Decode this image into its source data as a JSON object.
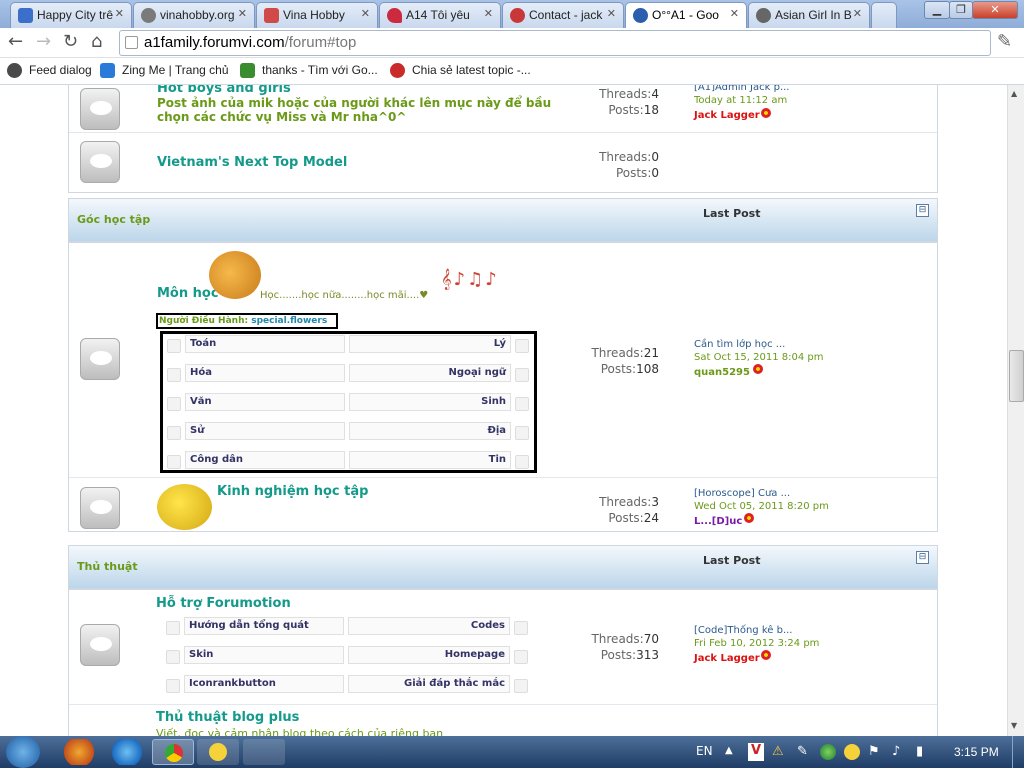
{
  "tabs": [
    {
      "label": "Happy City trê",
      "color": "#3b6fc9"
    },
    {
      "label": "vinahobby.org",
      "color": "#7a7a7a"
    },
    {
      "label": "Vina Hobby",
      "color": "#d04a4a"
    },
    {
      "label": "A14 Tôi yêu",
      "color": "#cc2b3f"
    },
    {
      "label": "Contact - jack",
      "color": "#c93838"
    },
    {
      "label": "O°°A1 - Goo",
      "color": "#2b5fae"
    },
    {
      "label": "Asian Girl In B",
      "color": "#666666"
    }
  ],
  "toolbar": {
    "url_domain": "a1family.forumvi.com",
    "url_path": "/forum#top"
  },
  "bookmarks": [
    {
      "label": "Feed dialog",
      "color": "#4a4a4a"
    },
    {
      "label": "Zing Me | Trang chủ",
      "color": "#2a7ad9"
    },
    {
      "label": "thanks - Tìm với Go...",
      "color": "#3a8d2e"
    },
    {
      "label": "Chia sẻ latest topic -...",
      "color": "#c92b2b"
    }
  ],
  "forum": {
    "hot": {
      "title": "Hot boys and girls",
      "desc": "Post ảnh của mik hoặc của người khác lên mục này để bầu chọn các chức vụ Miss và Mr nha^0^",
      "threads_label": "Threads:",
      "threads": "4",
      "posts_label": "Posts:",
      "posts": "18",
      "lp_title": "[A1]Admin Jack p...",
      "lp_date": "Today at 11:12 am",
      "lp_user": "Jack Lagger"
    },
    "vntm": {
      "title": "Vietnam's Next Top Model",
      "threads_label": "Threads:",
      "threads": "0",
      "posts_label": "Posts:",
      "posts": "0"
    },
    "cat1": {
      "title": "Góc học tập",
      "last_post": "Last Post",
      "collapse": "⊟"
    },
    "monhoc": {
      "title": "Môn học",
      "desc": "Học.......học nữa........học mãi....♥",
      "mod_label": "Người Điều Hành:",
      "mod_user": "special.flowers",
      "threads_label": "Threads:",
      "threads": "21",
      "posts_label": "Posts:",
      "posts": "108",
      "lp_title": "Cần tìm lớp học ...",
      "lp_date": "Sat Oct 15, 2011 8:04 pm",
      "lp_user": "quan5295",
      "subs_left": [
        "Toán",
        "Hóa",
        "Văn",
        "Sử",
        "Công dân"
      ],
      "subs_right": [
        "Lý",
        "Ngoại ngữ",
        "Sinh",
        "Địa",
        "Tin"
      ]
    },
    "kinhnghiem": {
      "title": "Kinh nghiệm học tập",
      "threads_label": "Threads:",
      "threads": "3",
      "posts_label": "Posts:",
      "posts": "24",
      "lp_title": "[Horoscope] Cưa ...",
      "lp_date": "Wed Oct 05, 2011 8:20 pm",
      "lp_user": "L...[D]uc"
    },
    "cat2": {
      "title": "Thủ thuật",
      "last_post": "Last Post",
      "collapse": "⊟"
    },
    "hotro": {
      "title": "Hỗ trợ Forumotion",
      "threads_label": "Threads:",
      "threads": "70",
      "posts_label": "Posts:",
      "posts": "313",
      "lp_title": "[Code]Thống kê b...",
      "lp_date": "Fri Feb 10, 2012 3:24 pm",
      "lp_user": "Jack Lagger",
      "subs_left": [
        "Hướng dẫn tổng quát",
        "Skin",
        "Iconrankbutton"
      ],
      "subs_right": [
        "Codes",
        "Homepage",
        "Giải đáp thắc mắc"
      ]
    },
    "blog": {
      "title": "Thủ thuật blog plus",
      "desc": "Viết, đọc và cảm nhận blog theo cách của riêng bạn"
    }
  },
  "taskbar": {
    "lang": "EN",
    "time": "3:15 PM"
  }
}
